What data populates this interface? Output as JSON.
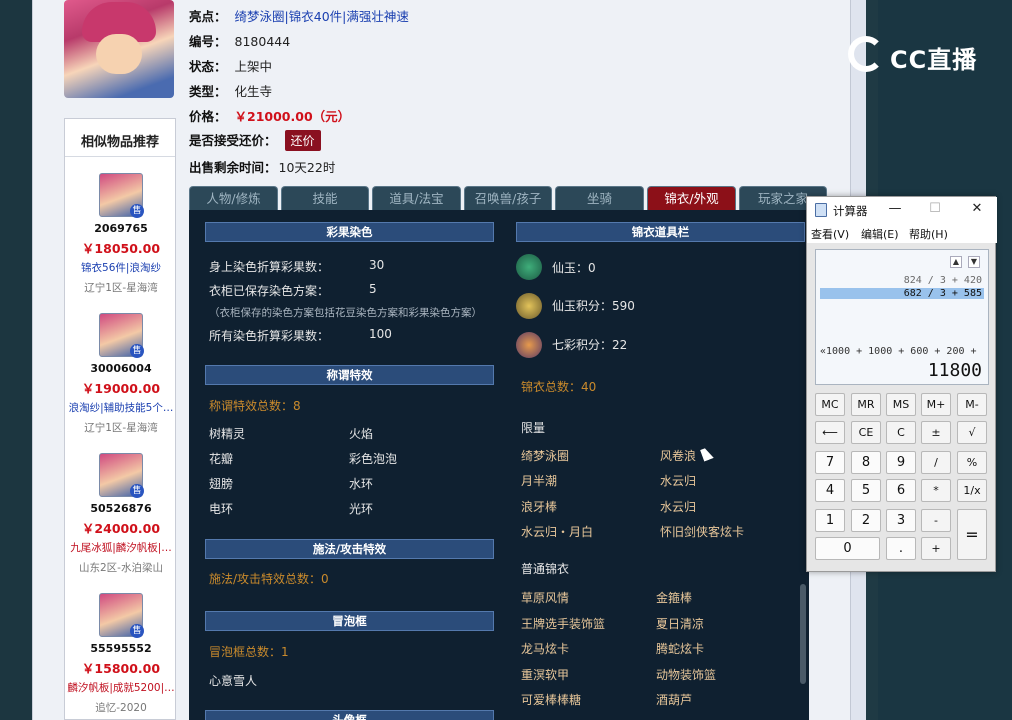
{
  "item": {
    "highlights_label": "亮点：",
    "highlights": [
      "绮梦泳圈",
      "锦衣40件",
      "满强壮神速"
    ],
    "id_label": "编号：",
    "id": "8180444",
    "status_label": "状态：",
    "status": "上架中",
    "type_label": "类型：",
    "type": "化生寺",
    "price_label": "价格：",
    "price": "￥21000.00（元）",
    "haggle_label": "是否接受还价：",
    "haggle_button": "还价",
    "remaining_label": "出售剩余时间：",
    "remaining": "10天22时"
  },
  "similar": {
    "title": "相似物品推荐",
    "items": [
      {
        "tag": "售",
        "id": "2069765",
        "price": "￥18050.00",
        "tags": "锦衣56件|浪淘纱",
        "server": "辽宁1区-星海湾",
        "tags_color": "#1a3fb0"
      },
      {
        "tag": "售",
        "id": "30006004",
        "price": "￥19000.00",
        "tags": "浪淘纱|辅助技能5个…",
        "server": "辽宁1区-星海湾",
        "tags_color": "#1a3fb0"
      },
      {
        "tag": "售",
        "id": "50526876",
        "price": "￥24000.00",
        "tags": "九尾冰狐|麟汐帆板|…",
        "server": "山东2区-水泊梁山",
        "tags_color": "#c01020"
      },
      {
        "tag": "售",
        "id": "55595552",
        "price": "￥15800.00",
        "tags": "麟汐帆板|成就5200|…",
        "server": "追忆-2020",
        "tags_color": "#c01020"
      }
    ]
  },
  "tabs": [
    "人物/修炼",
    "技能",
    "道具/法宝",
    "召唤兽/孩子",
    "坐骑",
    "锦衣/外观",
    "玩家之家"
  ],
  "active_tab": 5,
  "panel": {
    "dye": {
      "title": "彩果染色",
      "rows": [
        {
          "label": "身上染色折算彩果数：",
          "value": "30"
        },
        {
          "label": "衣柜已保存染色方案：",
          "value": "5"
        },
        {
          "label": "所有染色折算彩果数：",
          "value": "100"
        }
      ],
      "note": "（衣柜保存的染色方案包括花豆染色方案和彩果染色方案）"
    },
    "title_fx": {
      "title": "称谓特效",
      "total": "称谓特效总数：8",
      "items": [
        "树精灵",
        "火焰",
        "花瓣",
        "彩色泡泡",
        "翅膀",
        "水环",
        "电环",
        "光环"
      ]
    },
    "spell_fx": {
      "title": "施法/攻击特效",
      "total": "施法/攻击特效总数：0"
    },
    "bubble": {
      "title": "冒泡框",
      "total": "冒泡框总数：1",
      "items": [
        "心意雪人"
      ]
    },
    "next_title": "头像框",
    "wardrobe": {
      "title": "锦衣道具栏",
      "xianyu": "仙玉：0",
      "xianyu_points": "仙玉积分：590",
      "rainbow_points": "七彩积分：22",
      "total": "锦衣总数：40",
      "limited_title": "限量",
      "limited": [
        "绮梦泳圈",
        "风卷浪",
        "月半潮",
        "水云归",
        "浪牙棒",
        "水云归",
        "水云归・月白",
        "怀旧剑侠客炫卡"
      ],
      "normal_title": "普通锦衣",
      "normal": [
        "草原风情",
        "金箍棒",
        "王牌选手装饰篮",
        "夏日清凉",
        "龙马炫卡",
        "腾蛇炫卡",
        "重溟软甲",
        "动物装饰篮",
        "可爱棒棒糖",
        "酒葫芦"
      ]
    }
  },
  "calculator": {
    "title": "计算器",
    "menu": [
      "查看(V)",
      "编辑(E)",
      "帮助(H)"
    ],
    "history": [
      "824 / 3 + 420",
      "682 / 3 + 585"
    ],
    "expression": "«1000 + 1000 + 600 + 200 +",
    "result": "11800",
    "keys": [
      "MC",
      "MR",
      "MS",
      "M+",
      "M-",
      "⟵",
      "CE",
      "C",
      "±",
      "√",
      "7",
      "8",
      "9",
      "/",
      "%",
      "4",
      "5",
      "6",
      "*",
      "1/x",
      "1",
      "2",
      "3",
      "-",
      "=",
      "0",
      ".",
      "+"
    ]
  },
  "watermark": "CC直播",
  "colors": {
    "accent": "#8c1018",
    "price": "#d0101a",
    "link": "#1a3fb0",
    "panel_bg": "#0f2030"
  }
}
